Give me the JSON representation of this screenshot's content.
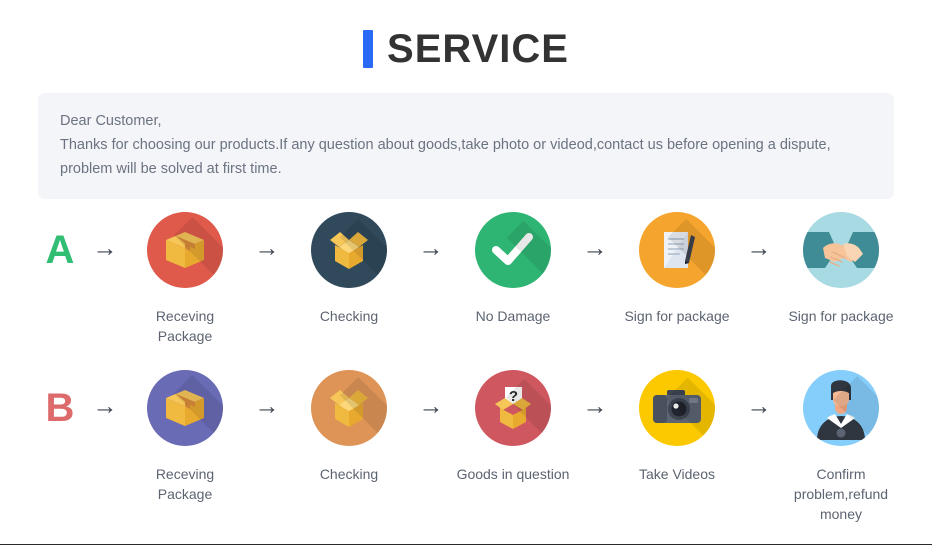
{
  "header": {
    "accent_color": "#2a6bf5",
    "title": "SERVICE"
  },
  "notice": {
    "background_color": "#f4f5f9",
    "lines": [
      "Dear Customer,",
      "Thanks for choosing our products.If any question about goods,take photo or videod,contact us before opening a dispute,",
      "problem will be solved at first time."
    ]
  },
  "flows": [
    {
      "letter": "A",
      "letter_color": "#32be72",
      "arrow": "→",
      "steps": [
        {
          "icon": "package-box-icon",
          "circle_color": "#e05a4b",
          "label": "Receving Package"
        },
        {
          "icon": "open-box-icon",
          "circle_color": "#30495b",
          "label": "Checking"
        },
        {
          "icon": "check-mark-icon",
          "circle_color": "#2fb573",
          "label": "No Damage"
        },
        {
          "icon": "document-signature-icon",
          "circle_color": "#f5a52e",
          "label": "Sign for package"
        },
        {
          "icon": "handshake-icon",
          "circle_color": "#a8dae3",
          "label": "Sign for package"
        }
      ]
    },
    {
      "letter": "B",
      "letter_color": "#dd6b6b",
      "arrow": "→",
      "steps": [
        {
          "icon": "package-box-icon",
          "circle_color": "#6a6bb5",
          "label": "Receving Package"
        },
        {
          "icon": "open-box-icon",
          "circle_color": "#dd9456",
          "label": "Checking"
        },
        {
          "icon": "question-box-icon",
          "circle_color": "#cf5860",
          "label": "Goods in question"
        },
        {
          "icon": "camera-icon",
          "circle_color": "#fcc800",
          "label": "Take Videos"
        },
        {
          "icon": "support-person-icon",
          "circle_color": "#85cdfb",
          "label": "Confirm problem,refund money"
        }
      ]
    }
  ]
}
